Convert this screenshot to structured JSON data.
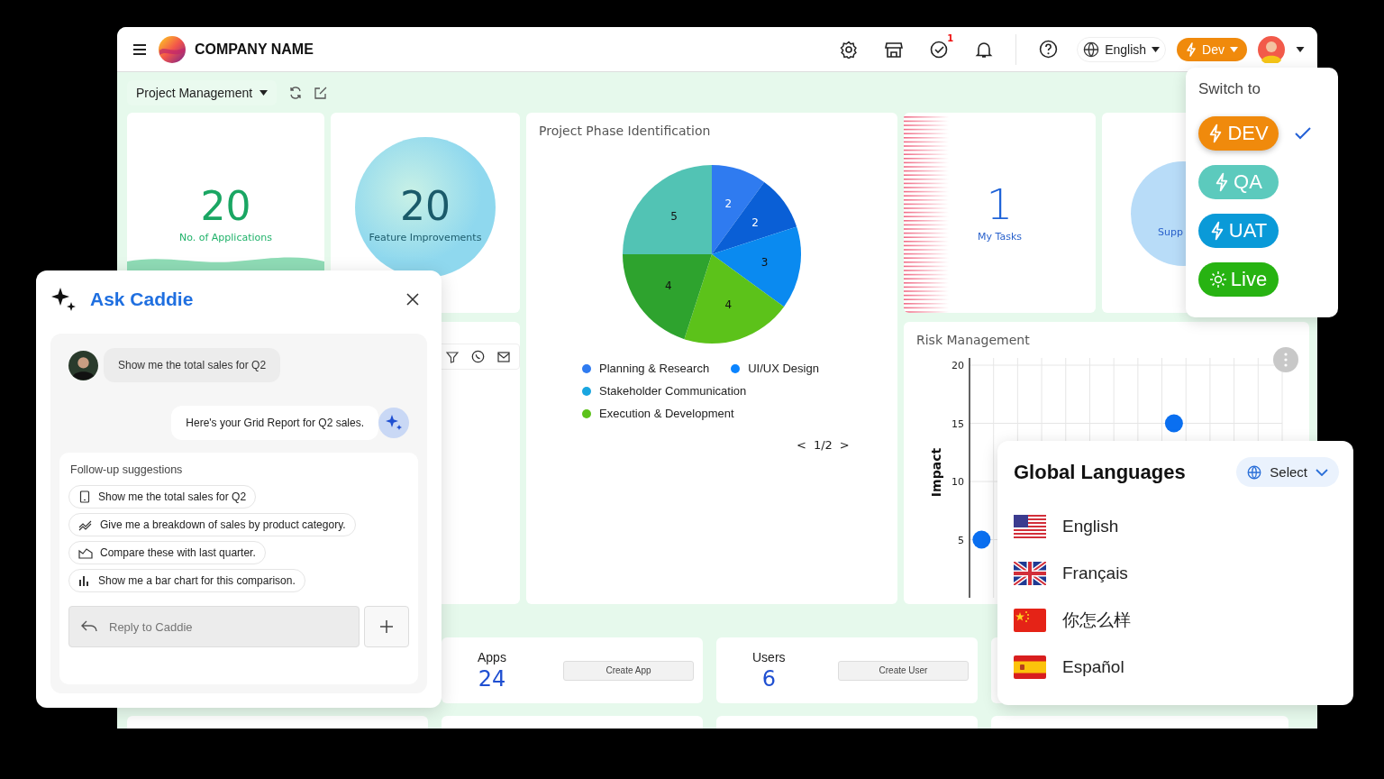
{
  "header": {
    "brand": "COMPANY NAME",
    "task_badge": "1",
    "language": "English",
    "environment": "Dev"
  },
  "toolbar": {
    "view": "Project Management"
  },
  "stat_cards": [
    {
      "value": "20",
      "label": "No. of Applications",
      "kind": "wave"
    },
    {
      "value": "20",
      "label": "Feature Improvements",
      "kind": "bubble"
    }
  ],
  "phase_card": {
    "title": "Project Phase Identification",
    "chart_data": {
      "type": "pie",
      "series": [
        {
          "values": [
            2,
            2,
            3,
            4,
            4,
            5
          ]
        }
      ],
      "data_labels": true
    },
    "legend": [
      {
        "label": "Planning & Research",
        "color": "#2f7bf0"
      },
      {
        "label": "UI/UX Design",
        "color": "#0a84ff"
      },
      {
        "label": "Stakeholder Communication",
        "color": "#1aa6e0"
      },
      {
        "label": "Execution & Development",
        "color": "#5cc21a"
      }
    ],
    "pager": {
      "prev": "<",
      "label": "1/2",
      "next": ">"
    }
  },
  "tasks_card": {
    "value": "1",
    "label": "My Tasks"
  },
  "support_card": {
    "label": "Supp"
  },
  "risk_card": {
    "title": "Risk Management",
    "chart_data": {
      "type": "scatter",
      "ylabel": "Impact",
      "yticks": [
        5,
        10,
        15,
        20
      ],
      "ylim": [
        0,
        20
      ],
      "grid": true,
      "categories": [
        null,
        null,
        null,
        null,
        null,
        null,
        null,
        null,
        null,
        null,
        null,
        null,
        null
      ],
      "series": [
        {
          "color": "#0a6ff0",
          "values": [
            5,
            null,
            null,
            null,
            null,
            null,
            null,
            null,
            15,
            null,
            null,
            null,
            null
          ]
        }
      ]
    }
  },
  "summary_cards": [
    {
      "label": "Apps",
      "value": "24",
      "action": "Create App"
    },
    {
      "label": "Users",
      "value": "6",
      "action": "Create User"
    }
  ],
  "caddie": {
    "title": "Ask Caddie",
    "messages": [
      {
        "kind": "user",
        "text": "Show me the total sales for Q2"
      },
      {
        "kind": "assistant",
        "text": "Here's your Grid Report for Q2 sales."
      }
    ],
    "suggestions_title": "Follow-up suggestions",
    "suggestions": [
      {
        "kind": "report",
        "text": "Show me the total sales for Q2"
      },
      {
        "kind": "trend",
        "text": "Give me a breakdown of sales by product category."
      },
      {
        "kind": "area",
        "text": "Compare these with last quarter."
      },
      {
        "kind": "bars",
        "text": "Show me a bar chart for this comparison."
      }
    ],
    "reply_placeholder": "Reply to Caddie"
  },
  "env_menu": {
    "title": "Switch to",
    "options": [
      {
        "label": "DEV",
        "kind": "bolt",
        "color": "#f08a0c",
        "selected": true
      },
      {
        "label": "QA",
        "kind": "bolt",
        "color": "#5ccabd",
        "selected": false
      },
      {
        "label": "UAT",
        "kind": "bolt",
        "color": "#0a9ad8",
        "selected": false
      },
      {
        "label": "Live",
        "kind": "sun",
        "color": "#27b312",
        "selected": false
      }
    ]
  },
  "languages": {
    "title": "Global Languages",
    "select": "Select",
    "items": [
      {
        "label": "English",
        "kind": "us"
      },
      {
        "label": "Français",
        "kind": "uk"
      },
      {
        "label": "你怎么样",
        "kind": "cn"
      },
      {
        "label": "Español",
        "kind": "es"
      }
    ]
  }
}
